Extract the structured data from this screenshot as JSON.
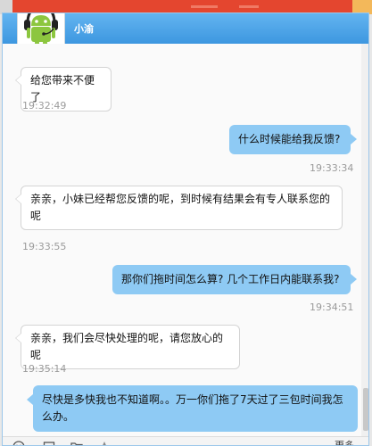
{
  "contact": {
    "name": "小渝",
    "avatar_icon": "android-headset-icon"
  },
  "messages": [
    {
      "side": "left",
      "text": "给您带来不便了",
      "time": "19:32:49"
    },
    {
      "side": "right",
      "text": "什么时候能给我反馈?",
      "time": "19:33:34"
    },
    {
      "side": "left",
      "text": "亲亲，小妹已经帮您反馈的呢，到时候有结果会有专人联系您的呢",
      "time": "19:33:55"
    },
    {
      "side": "right",
      "text": "那你们拖时间怎么算? 几个工作日内能联系我?",
      "time": "19:34:51"
    },
    {
      "side": "left",
      "text": "亲亲，我们会尽快处理的呢，请您放心的呢",
      "time": "19:35:14"
    },
    {
      "side": "right",
      "text": "尽快是多快我也不知道啊。。万一你们拖了7天过了三包时间我怎么办。",
      "time": ""
    }
  ],
  "toolbar": {
    "icons": [
      "emoji-icon",
      "screenshot-icon",
      "folder-icon",
      "star-icon"
    ],
    "more_label": "更多"
  },
  "colors": {
    "header": "#4aa3e8",
    "right_bubble": "#8ecaf4",
    "accent_strip": "#e4462f"
  }
}
